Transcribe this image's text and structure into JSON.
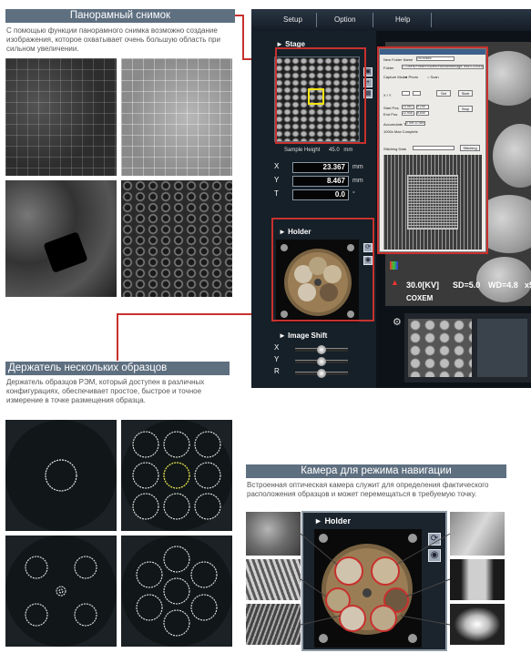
{
  "panorama": {
    "title": "Панорамный снимок",
    "description": "С помощью функции панорамного снимка возможно создание изображения, которое охватывает очень большую область при сильном увеличении."
  },
  "multi_holder": {
    "title": "Держатель нескольких образцов",
    "description": "Держатель образцов РЭМ, который доступен в различных конфигурациях, обеспечивает простое, быстрое и точное измерение в точке размещения образца."
  },
  "nav_camera": {
    "title": "Камера для режима навигации",
    "description": "Встроенная оптическая камера служит для определения фактического расположения образцов и может перемещаться в требуемую точку.",
    "panel_title": "Holder"
  },
  "app": {
    "menu": [
      "Setup",
      "Option",
      "Help"
    ],
    "stage_title": "Stage",
    "sample_height_label": "Sample Height",
    "sample_height_value": "45.0",
    "sample_height_unit": "mm",
    "x_label": "X",
    "x_value": "23.367",
    "x_unit": "mm",
    "y_label": "Y",
    "y_value": "8.467",
    "y_unit": "mm",
    "t_label": "T",
    "t_value": "0.0",
    "t_unit": "°",
    "holder_title": "Holder",
    "image_shift_title": "Image Shift",
    "shift_labels": [
      "X",
      "Y",
      "R"
    ],
    "status": {
      "kv": "30.0[KV]",
      "sd": "SD=5.0",
      "wd": "WD=4.8",
      "mag": "x5",
      "brand": "COXEM"
    }
  },
  "dialog": {
    "rows": {
      "new_folder": "New Folder Name",
      "folder": "Folder",
      "capture_mode": "Capture Mode",
      "xy": "X / Y",
      "start_pos": "Start Pos.",
      "end_pos": "End Pos.",
      "accumulate": "Accumulate Time",
      "overlap": "1000x Max Complete",
      "stitching": "Stitching Data"
    },
    "values": {
      "new_folder": "20190846",
      "folder": "C:/Users/Public/Pictures/PanoramicImage/Test/20190846",
      "start_x": "23.563",
      "start_y": "9.245",
      "end_x": "22.948",
      "end_y": "8.645",
      "accumulate": "0 min 10 sec"
    },
    "radio_photo": "Photo",
    "radio_scan": "Scan",
    "buttons": {
      "set": "Set",
      "start": "Start",
      "stop": "Stop",
      "stitching": "Stitching"
    }
  },
  "colors": {
    "section_header": "#5e6f80",
    "highlight_red": "#c8312e",
    "selection_yellow": "#f2e30e"
  }
}
